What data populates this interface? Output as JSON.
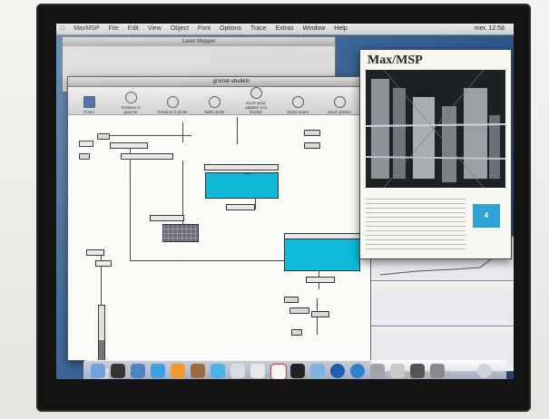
{
  "menubar": {
    "items": [
      "MaxMSP",
      "File",
      "Edit",
      "View",
      "Object",
      "Font",
      "Options",
      "Trace",
      "Extras",
      "Window",
      "Help"
    ],
    "clock": "mer. 12:58"
  },
  "back_window": {
    "title": "Laser Mapper"
  },
  "patch_window": {
    "title": "grsmat-vbulletn",
    "toolbar": [
      "Finder",
      "Rotation à gauche",
      "Rotation à droite",
      "Taille réelle",
      "Zoom pour adapter à la fenêtre",
      "Zoom avant",
      "Zoom arrière"
    ]
  },
  "about_window": {
    "title": "Max/MSP",
    "badge": "4"
  }
}
